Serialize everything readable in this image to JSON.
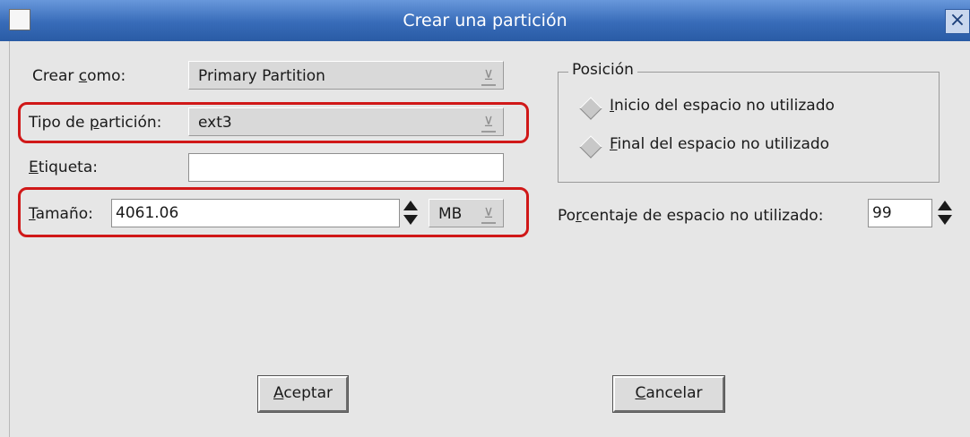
{
  "window": {
    "title": "Crear una partición"
  },
  "form": {
    "crear_como": {
      "label_before": "Crear ",
      "label_mnemonic": "c",
      "label_after": "omo:",
      "value": "Primary Partition"
    },
    "tipo": {
      "label_before": "Tipo de ",
      "label_mnemonic": "p",
      "label_after": "artición:",
      "value": "ext3"
    },
    "etiqueta": {
      "label_mnemonic": "E",
      "label_after": "tiqueta:",
      "value": ""
    },
    "tamano": {
      "label_mnemonic": "T",
      "label_after": "amaño:",
      "value": "4061.06",
      "unit": "MB"
    }
  },
  "posicion": {
    "title": "Posición",
    "inicio": {
      "mnemonic": "I",
      "rest": "nicio del espacio no utilizado"
    },
    "final": {
      "mnemonic": "F",
      "rest": "inal del espacio no utilizado"
    }
  },
  "porcentaje": {
    "label_before": "Po",
    "label_mnemonic": "r",
    "label_after": "centaje de espacio no utilizado:",
    "value": "99"
  },
  "buttons": {
    "aceptar": {
      "mnemonic": "A",
      "rest": "ceptar"
    },
    "cancelar": {
      "mnemonic": "C",
      "rest": "ancelar"
    }
  },
  "colors": {
    "titlebar": "#3b70bc",
    "highlight": "#d01818",
    "dialog_bg": "#e6e6e6"
  },
  "icons": {
    "close": "close-icon",
    "combo_arrow": "chevron-down-icon",
    "spin": "spin-arrows-icon",
    "cursor": "mouse-pointer-icon"
  }
}
